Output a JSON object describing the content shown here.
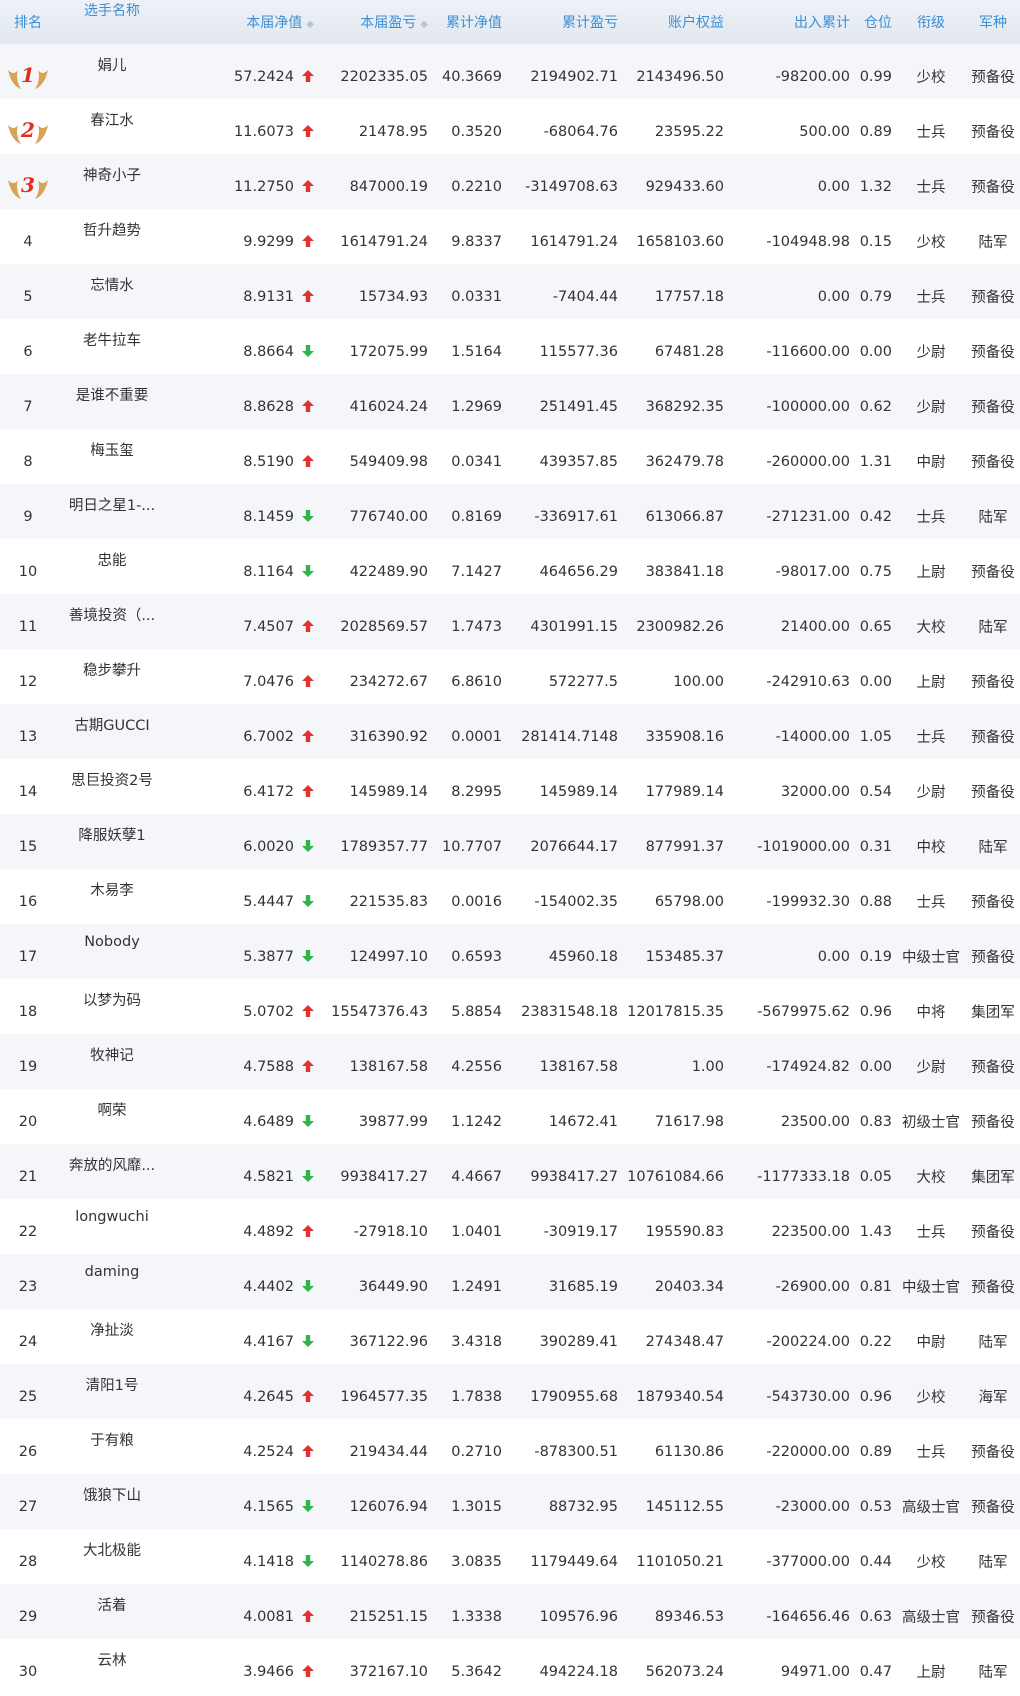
{
  "colors": {
    "header_text": "#3d8fd6",
    "up": "#e3312f",
    "down": "#2fb54a",
    "medal_wing": "#d9a357",
    "medal_number": "#e32d1f"
  },
  "headers": {
    "rank": "排名",
    "name": "选手名称",
    "nav": "本届净值",
    "pnl": "本届盈亏",
    "cum_nav": "累计净值",
    "cum_pnl": "累计盈亏",
    "equity": "账户权益",
    "flow": "出入累计",
    "position": "仓位",
    "title": "衔级",
    "branch": "军种"
  },
  "rows": [
    {
      "rank": "1",
      "medal": "1",
      "name": "娟儿",
      "nav": "57.2424",
      "trend": "up",
      "pnl": "2202335.05",
      "cum_nav": "40.3669",
      "cum_pnl": "2194902.71",
      "equity": "2143496.50",
      "flow": "-98200.00",
      "position": "0.99",
      "title": "少校",
      "branch": "预备役"
    },
    {
      "rank": "2",
      "medal": "2",
      "name": "春江水",
      "nav": "11.6073",
      "trend": "up",
      "pnl": "21478.95",
      "cum_nav": "0.3520",
      "cum_pnl": "-68064.76",
      "equity": "23595.22",
      "flow": "500.00",
      "position": "0.89",
      "title": "士兵",
      "branch": "预备役"
    },
    {
      "rank": "3",
      "medal": "3",
      "name": "神奇小子",
      "nav": "11.2750",
      "trend": "up",
      "pnl": "847000.19",
      "cum_nav": "0.2210",
      "cum_pnl": "-3149708.63",
      "equity": "929433.60",
      "flow": "0.00",
      "position": "1.32",
      "title": "士兵",
      "branch": "预备役"
    },
    {
      "rank": "4",
      "name": "哲升趋势",
      "nav": "9.9299",
      "trend": "up",
      "pnl": "1614791.24",
      "cum_nav": "9.8337",
      "cum_pnl": "1614791.24",
      "equity": "1658103.60",
      "flow": "-104948.98",
      "position": "0.15",
      "title": "少校",
      "branch": "陆军"
    },
    {
      "rank": "5",
      "name": "忘情水",
      "nav": "8.9131",
      "trend": "up",
      "pnl": "15734.93",
      "cum_nav": "0.0331",
      "cum_pnl": "-7404.44",
      "equity": "17757.18",
      "flow": "0.00",
      "position": "0.79",
      "title": "士兵",
      "branch": "预备役"
    },
    {
      "rank": "6",
      "name": "老牛拉车",
      "nav": "8.8664",
      "trend": "down",
      "pnl": "172075.99",
      "cum_nav": "1.5164",
      "cum_pnl": "115577.36",
      "equity": "67481.28",
      "flow": "-116600.00",
      "position": "0.00",
      "title": "少尉",
      "branch": "预备役"
    },
    {
      "rank": "7",
      "name": "是谁不重要",
      "nav": "8.8628",
      "trend": "up",
      "pnl": "416024.24",
      "cum_nav": "1.2969",
      "cum_pnl": "251491.45",
      "equity": "368292.35",
      "flow": "-100000.00",
      "position": "0.62",
      "title": "少尉",
      "branch": "预备役"
    },
    {
      "rank": "8",
      "name": "梅玉玺",
      "nav": "8.5190",
      "trend": "up",
      "pnl": "549409.98",
      "cum_nav": "0.0341",
      "cum_pnl": "439357.85",
      "equity": "362479.78",
      "flow": "-260000.00",
      "position": "1.31",
      "title": "中尉",
      "branch": "预备役"
    },
    {
      "rank": "9",
      "name": "明日之星1-...",
      "nav": "8.1459",
      "trend": "down",
      "pnl": "776740.00",
      "cum_nav": "0.8169",
      "cum_pnl": "-336917.61",
      "equity": "613066.87",
      "flow": "-271231.00",
      "position": "0.42",
      "title": "士兵",
      "branch": "陆军"
    },
    {
      "rank": "10",
      "name": "忠能",
      "nav": "8.1164",
      "trend": "down",
      "pnl": "422489.90",
      "cum_nav": "7.1427",
      "cum_pnl": "464656.29",
      "equity": "383841.18",
      "flow": "-98017.00",
      "position": "0.75",
      "title": "上尉",
      "branch": "预备役"
    },
    {
      "rank": "11",
      "name": "善境投资（...",
      "nav": "7.4507",
      "trend": "up",
      "pnl": "2028569.57",
      "cum_nav": "1.7473",
      "cum_pnl": "4301991.15",
      "equity": "2300982.26",
      "flow": "21400.00",
      "position": "0.65",
      "title": "大校",
      "branch": "陆军"
    },
    {
      "rank": "12",
      "name": "稳步攀升",
      "nav": "7.0476",
      "trend": "up",
      "pnl": "234272.67",
      "cum_nav": "6.8610",
      "cum_pnl": "572277.5",
      "equity": "100.00",
      "flow": "-242910.63",
      "position": "0.00",
      "title": "上尉",
      "branch": "预备役"
    },
    {
      "rank": "13",
      "name": "古期GUCCI",
      "nav": "6.7002",
      "trend": "up",
      "pnl": "316390.92",
      "cum_nav": "0.0001",
      "cum_pnl": "281414.7148",
      "equity": "335908.16",
      "flow": "-14000.00",
      "position": "1.05",
      "title": "士兵",
      "branch": "预备役"
    },
    {
      "rank": "14",
      "name": "思巨投资2号",
      "nav": "6.4172",
      "trend": "up",
      "pnl": "145989.14",
      "cum_nav": "8.2995",
      "cum_pnl": "145989.14",
      "equity": "177989.14",
      "flow": "32000.00",
      "position": "0.54",
      "title": "少尉",
      "branch": "预备役"
    },
    {
      "rank": "15",
      "name": "降服妖孽1",
      "nav": "6.0020",
      "trend": "down",
      "pnl": "1789357.77",
      "cum_nav": "10.7707",
      "cum_pnl": "2076644.17",
      "equity": "877991.37",
      "flow": "-1019000.00",
      "position": "0.31",
      "title": "中校",
      "branch": "陆军"
    },
    {
      "rank": "16",
      "name": "木易李",
      "nav": "5.4447",
      "trend": "down",
      "pnl": "221535.83",
      "cum_nav": "0.0016",
      "cum_pnl": "-154002.35",
      "equity": "65798.00",
      "flow": "-199932.30",
      "position": "0.88",
      "title": "士兵",
      "branch": "预备役"
    },
    {
      "rank": "17",
      "name": "Nobody",
      "nav": "5.3877",
      "trend": "down",
      "pnl": "124997.10",
      "cum_nav": "0.6593",
      "cum_pnl": "45960.18",
      "equity": "153485.37",
      "flow": "0.00",
      "position": "0.19",
      "title": "中级士官",
      "branch": "预备役"
    },
    {
      "rank": "18",
      "name": "以梦为码",
      "nav": "5.0702",
      "trend": "up",
      "pnl": "15547376.43",
      "cum_nav": "5.8854",
      "cum_pnl": "23831548.18",
      "equity": "12017815.35",
      "flow": "-5679975.62",
      "position": "0.96",
      "title": "中将",
      "branch": "集团军"
    },
    {
      "rank": "19",
      "name": "牧神记",
      "nav": "4.7588",
      "trend": "up",
      "pnl": "138167.58",
      "cum_nav": "4.2556",
      "cum_pnl": "138167.58",
      "equity": "1.00",
      "flow": "-174924.82",
      "position": "0.00",
      "title": "少尉",
      "branch": "预备役"
    },
    {
      "rank": "20",
      "name": "啊荣",
      "nav": "4.6489",
      "trend": "down",
      "pnl": "39877.99",
      "cum_nav": "1.1242",
      "cum_pnl": "14672.41",
      "equity": "71617.98",
      "flow": "23500.00",
      "position": "0.83",
      "title": "初级士官",
      "branch": "预备役"
    },
    {
      "rank": "21",
      "name": "奔放的风靡...",
      "nav": "4.5821",
      "trend": "down",
      "pnl": "9938417.27",
      "cum_nav": "4.4667",
      "cum_pnl": "9938417.27",
      "equity": "10761084.66",
      "flow": "-1177333.18",
      "position": "0.05",
      "title": "大校",
      "branch": "集团军"
    },
    {
      "rank": "22",
      "name": "longwuchi",
      "nav": "4.4892",
      "trend": "up",
      "pnl": "-27918.10",
      "cum_nav": "1.0401",
      "cum_pnl": "-30919.17",
      "equity": "195590.83",
      "flow": "223500.00",
      "position": "1.43",
      "title": "士兵",
      "branch": "预备役"
    },
    {
      "rank": "23",
      "name": "daming",
      "nav": "4.4402",
      "trend": "down",
      "pnl": "36449.90",
      "cum_nav": "1.2491",
      "cum_pnl": "31685.19",
      "equity": "20403.34",
      "flow": "-26900.00",
      "position": "0.81",
      "title": "中级士官",
      "branch": "预备役"
    },
    {
      "rank": "24",
      "name": "净扯淡",
      "nav": "4.4167",
      "trend": "down",
      "pnl": "367122.96",
      "cum_nav": "3.4318",
      "cum_pnl": "390289.41",
      "equity": "274348.47",
      "flow": "-200224.00",
      "position": "0.22",
      "title": "中尉",
      "branch": "陆军"
    },
    {
      "rank": "25",
      "name": "清阳1号",
      "nav": "4.2645",
      "trend": "up",
      "pnl": "1964577.35",
      "cum_nav": "1.7838",
      "cum_pnl": "1790955.68",
      "equity": "1879340.54",
      "flow": "-543730.00",
      "position": "0.96",
      "title": "少校",
      "branch": "海军"
    },
    {
      "rank": "26",
      "name": "于有粮",
      "nav": "4.2524",
      "trend": "up",
      "pnl": "219434.44",
      "cum_nav": "0.2710",
      "cum_pnl": "-878300.51",
      "equity": "61130.86",
      "flow": "-220000.00",
      "position": "0.89",
      "title": "士兵",
      "branch": "预备役"
    },
    {
      "rank": "27",
      "name": "饿狼下山",
      "nav": "4.1565",
      "trend": "down",
      "pnl": "126076.94",
      "cum_nav": "1.3015",
      "cum_pnl": "88732.95",
      "equity": "145112.55",
      "flow": "-23000.00",
      "position": "0.53",
      "title": "高级士官",
      "branch": "预备役"
    },
    {
      "rank": "28",
      "name": "大北极能",
      "nav": "4.1418",
      "trend": "down",
      "pnl": "1140278.86",
      "cum_nav": "3.0835",
      "cum_pnl": "1179449.64",
      "equity": "1101050.21",
      "flow": "-377000.00",
      "position": "0.44",
      "title": "少校",
      "branch": "陆军"
    },
    {
      "rank": "29",
      "name": "活着",
      "nav": "4.0081",
      "trend": "up",
      "pnl": "215251.15",
      "cum_nav": "1.3338",
      "cum_pnl": "109576.96",
      "equity": "89346.53",
      "flow": "-164656.46",
      "position": "0.63",
      "title": "高级士官",
      "branch": "预备役"
    },
    {
      "rank": "30",
      "name": "云林",
      "nav": "3.9466",
      "trend": "up",
      "pnl": "372167.10",
      "cum_nav": "5.3642",
      "cum_pnl": "494224.18",
      "equity": "562073.24",
      "flow": "94971.00",
      "position": "0.47",
      "title": "上尉",
      "branch": "陆军"
    }
  ]
}
